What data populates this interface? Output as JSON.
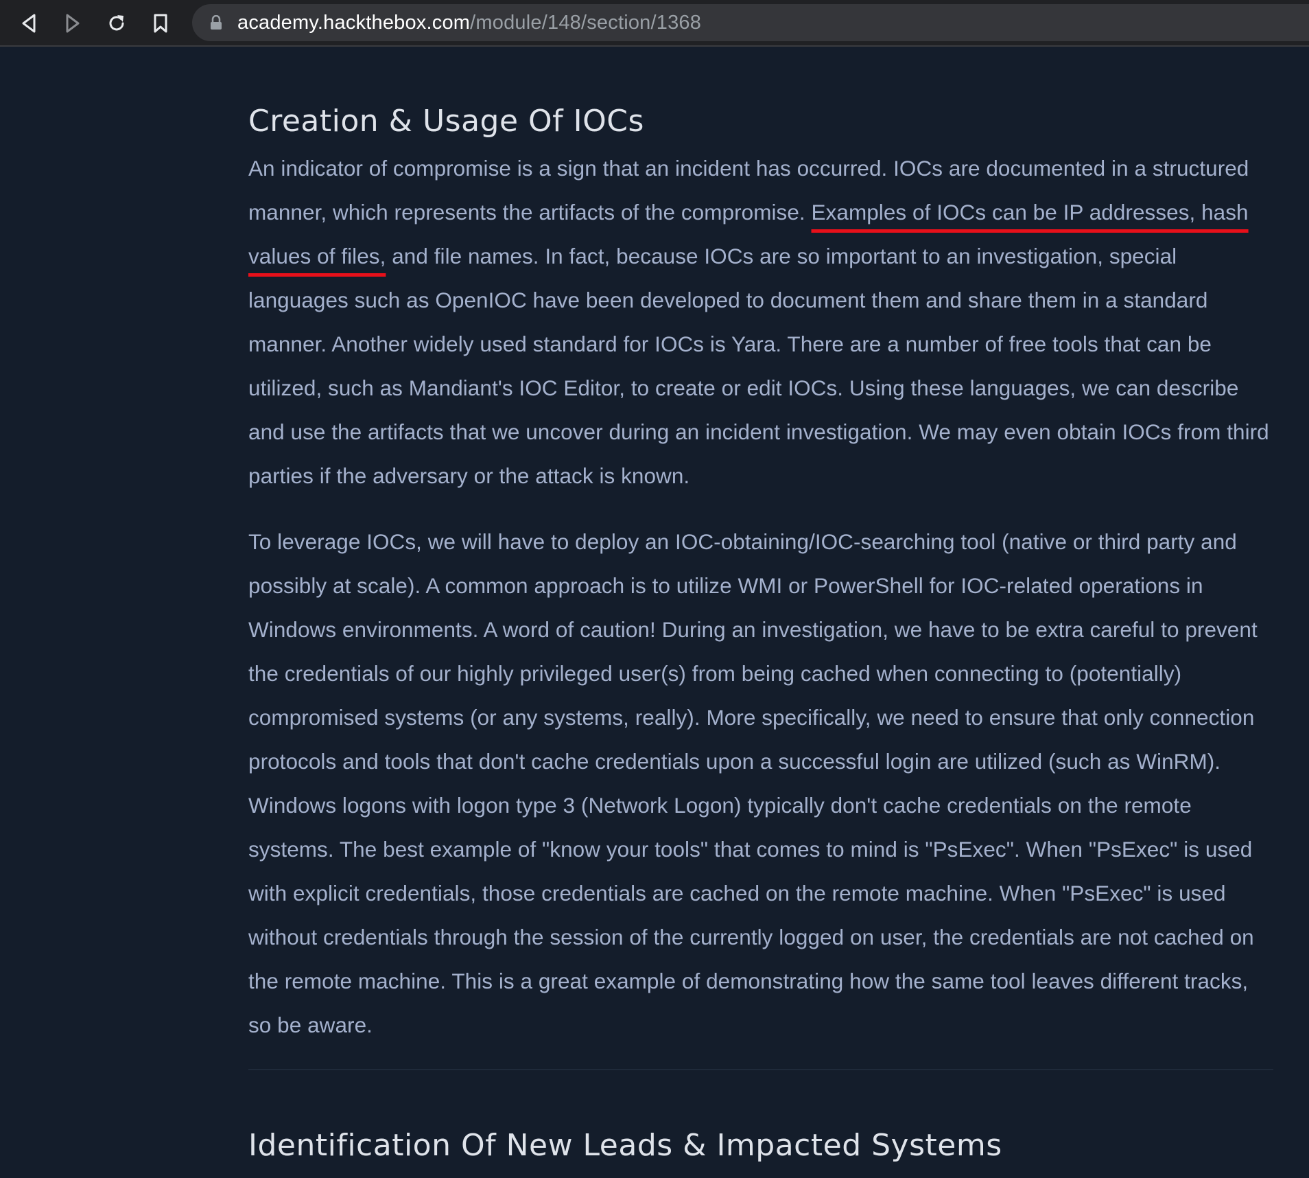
{
  "browser": {
    "url_host": "academy.hackthebox.com",
    "url_path": "/module/148/section/1368",
    "icons": {
      "back": "back-arrow-icon",
      "forward": "forward-arrow-icon",
      "reload": "reload-icon",
      "bookmark": "bookmark-icon",
      "lock": "lock-icon"
    }
  },
  "section": {
    "title": "Creation & Usage Of IOCs",
    "para1_pre": "An indicator of compromise is a sign that an incident has occurred. IOCs are documented in a structured manner, which represents the artifacts of the compromise. ",
    "para1_highlight": "Examples of IOCs can be IP addresses, hash values of files,",
    "para1_post": " and file names. In fact, because IOCs are so important to an investigation, special languages such as OpenIOC have been developed to document them and share them in a standard manner. Another widely used standard for IOCs is Yara. There are a number of free tools that can be utilized, such as Mandiant's IOC Editor, to create or edit IOCs. Using these languages, we can describe and use the artifacts that we uncover during an incident investigation. We may even obtain IOCs from third parties if the adversary or the attack is known.",
    "para2": "To leverage IOCs, we will have to deploy an IOC-obtaining/IOC-searching tool (native or third party and possibly at scale). A common approach is to utilize WMI or PowerShell for IOC-related operations in Windows environments. A word of caution! During an investigation, we have to be extra careful to prevent the credentials of our highly privileged user(s) from being cached when connecting to (potentially) compromised systems (or any systems, really). More specifically, we need to ensure that only connection protocols and tools that don't cache credentials upon a successful login are utilized (such as WinRM). Windows logons with logon type 3 (Network Logon) typically don't cache credentials on the remote systems. The best example of \"know your tools\" that comes to mind is \"PsExec\". When \"PsExec\" is used with explicit credentials, those credentials are cached on the remote machine. When \"PsExec\" is used without credentials through the session of the currently logged on user, the credentials are not cached on the remote machine. This is a great example of demonstrating how the same tool leaves different tracks, so be aware."
  },
  "next_section": {
    "title": "Identification Of New Leads & Impacted Systems"
  },
  "colors": {
    "page_bg": "#141d2b",
    "body_text": "#a4b1cd",
    "heading_text": "#dfe3ea",
    "highlight_underline": "#e8101a",
    "browser_bar": "#202124",
    "address_bar": "#35363a"
  }
}
